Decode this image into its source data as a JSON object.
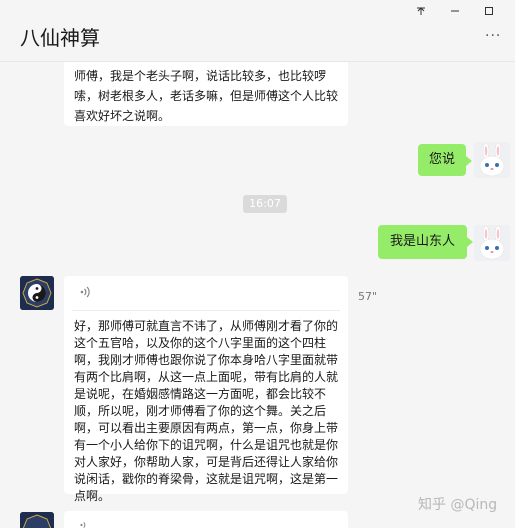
{
  "window": {
    "title": "八仙神算",
    "pin_glyph": "⁂",
    "min_glyph": "–",
    "max_glyph": "☐",
    "more_glyph": "···"
  },
  "messages": [
    {
      "side": "left",
      "text": "师傅，我是个老头子啊，说话比较多，也比较啰嗦，树老根多人，老话多嘛，但是师傅这个人比较喜欢好坏之说啊。"
    },
    {
      "side": "right",
      "text": "您说"
    },
    {
      "type": "time",
      "text": "16:07"
    },
    {
      "side": "right",
      "text": "我是山东人"
    },
    {
      "side": "left",
      "type": "voice",
      "duration": "57\"",
      "text": "好，那师傅可就直言不讳了，从师傅刚才看了你的这个五官哈，以及你的这个八字里面的这个四柱啊，我刚才师傅也跟你说了你本身哈八字里面就带有两个比肩啊，从这一点上面呢，带有比肩的人就是说呢，在婚姻感情路这一方面呢，都会比较不顺，所以呢，刚才师傅看了你的这个舞。关之后啊，可以看出主要原因有两点，第一点，你身上带有一个小人给你下的诅咒啊，什么是诅咒也就是你对人家好，你帮助人家，可是背后还得让人家给你说闲话，戳你的脊梁骨，这就是诅咒啊，这是第一点啊。"
    }
  ],
  "watermark": "知乎 @Qing",
  "colors": {
    "green_bubble": "#95ec69",
    "background": "#f5f5f5",
    "time_chip": "#dadada"
  },
  "icons": [
    "pin-icon",
    "minimize-icon",
    "maximize-icon",
    "more-icon",
    "rabbit-avatar",
    "taiji-avatar",
    "voice-icon"
  ]
}
